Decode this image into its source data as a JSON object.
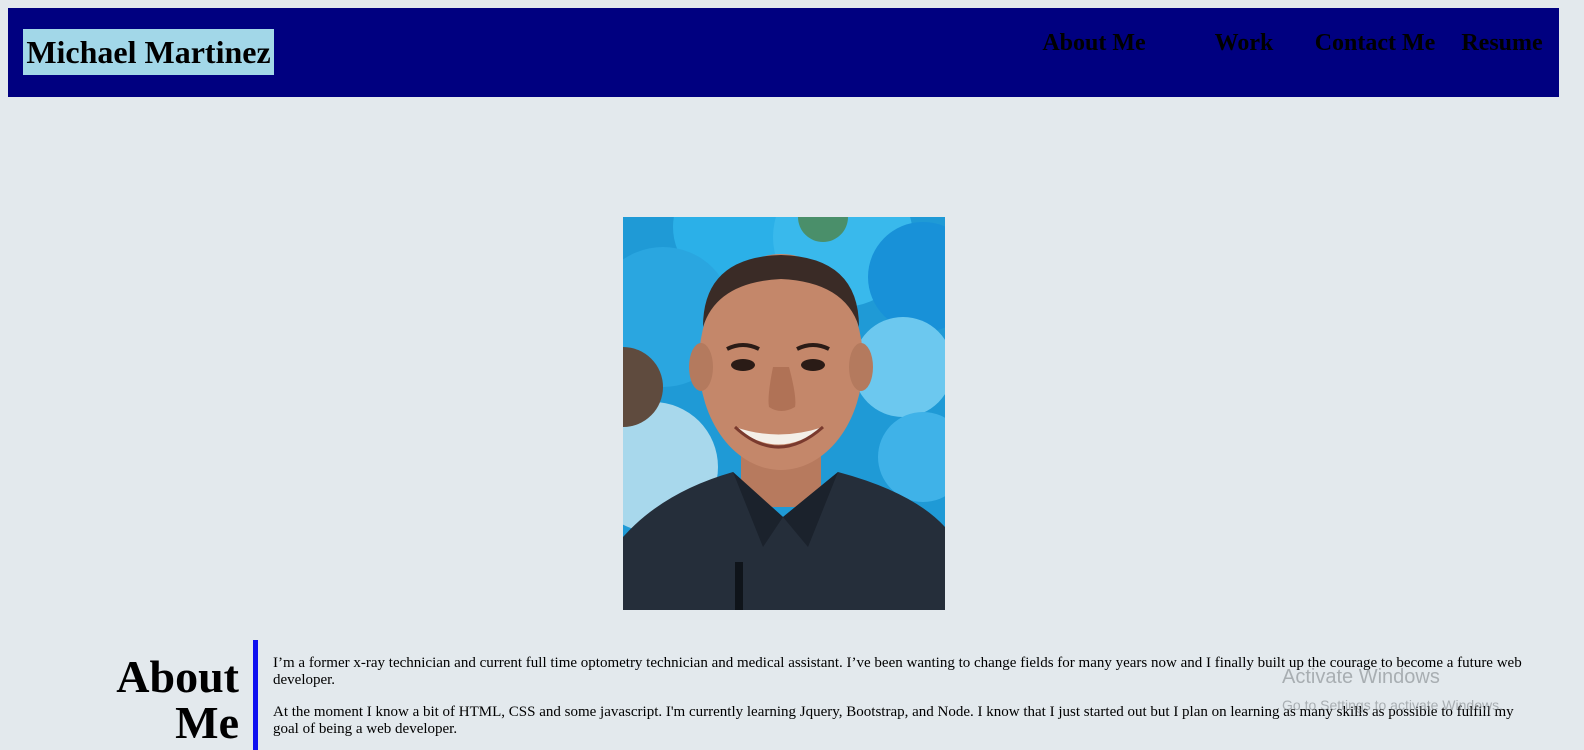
{
  "header": {
    "brand": "Michael Martinez",
    "nav": [
      {
        "label": "About Me"
      },
      {
        "label": "Work"
      },
      {
        "label": "Contact Me"
      },
      {
        "label": "Resume"
      }
    ],
    "background_color": "#000080",
    "brand_background_color": "#a2d7e8"
  },
  "hero": {
    "photo_icon": "profile-photo"
  },
  "about": {
    "heading": "About Me",
    "paragraphs": [
      "I’m a former x-ray technician and current full time optometry technician and medical assistant. I’ve been wanting to change fields for many years now and I finally built up the courage to become a future web developer.",
      "At the moment I know a bit of HTML, CSS and some javascript. I'm currently learning Jquery, Bootstrap, and Node. I know that I just started out but I plan on learning as many skills as possible to fulfill my goal of being a web developer."
    ],
    "divider_color": "#1010f0"
  },
  "watermark": {
    "title": "Activate Windows",
    "subtitle": "Go to Settings to activate Windows."
  },
  "page_background": "#e3e9ed"
}
